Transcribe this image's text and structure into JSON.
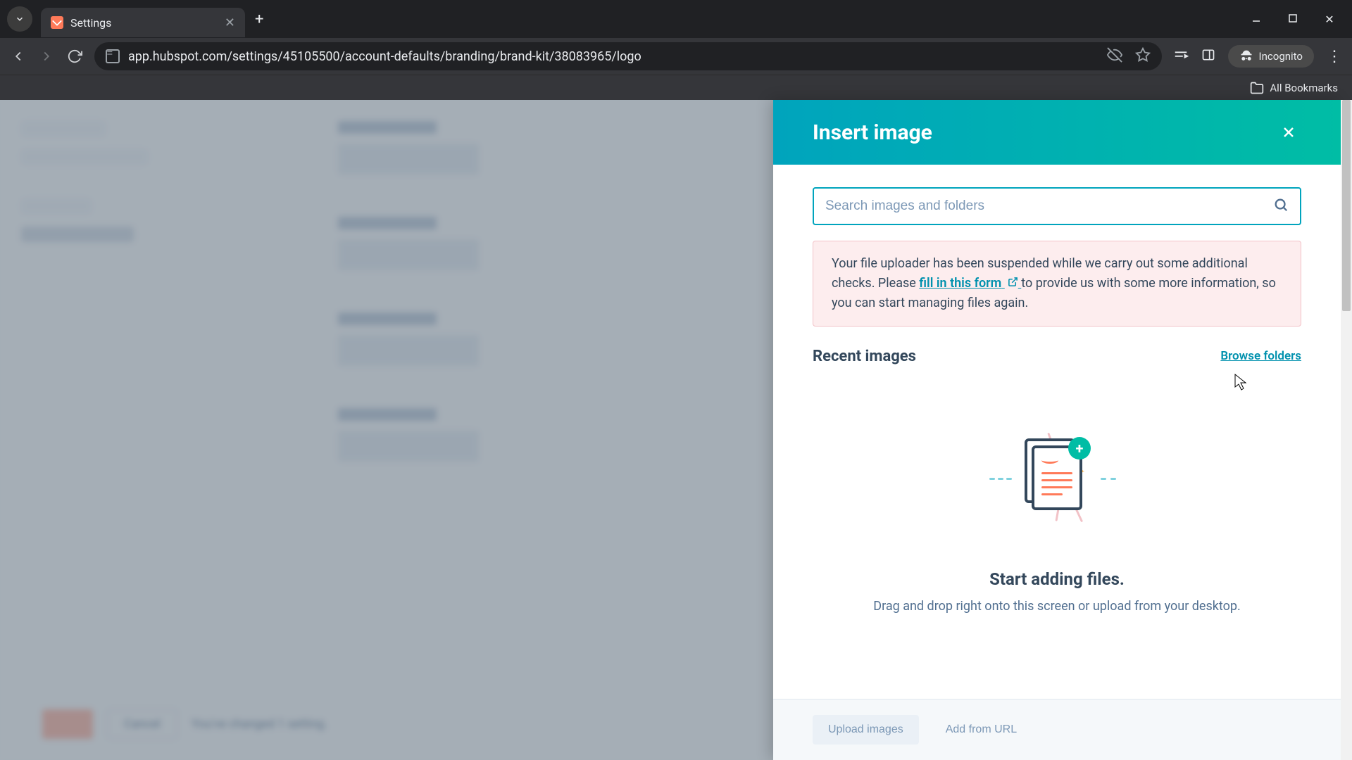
{
  "browser": {
    "tab_title": "Settings",
    "url": "app.hubspot.com/settings/45105500/account-defaults/branding/brand-kit/38083965/logo",
    "incognito_label": "Incognito",
    "all_bookmarks": "All Bookmarks"
  },
  "background": {
    "cancel_label": "Cancel",
    "changed_text": "You've changed 1 setting."
  },
  "panel": {
    "title": "Insert image",
    "search_placeholder": "Search images and folders",
    "alert": {
      "part1": "Your file uploader has been suspended while we carry out some additional checks. Please ",
      "link_text": "fill in this form",
      "part2": " to provide us with some more information, so you can start managing files again."
    },
    "recent_heading": "Recent images",
    "browse_link": "Browse folders",
    "empty_heading": "Start adding files.",
    "empty_sub": "Drag and drop right onto this screen or upload from your desktop.",
    "upload_btn": "Upload images",
    "url_btn": "Add from URL"
  },
  "colors": {
    "accent": "#00a4bd",
    "teal": "#00bda5",
    "orange": "#ff7a59",
    "text": "#33475b"
  }
}
